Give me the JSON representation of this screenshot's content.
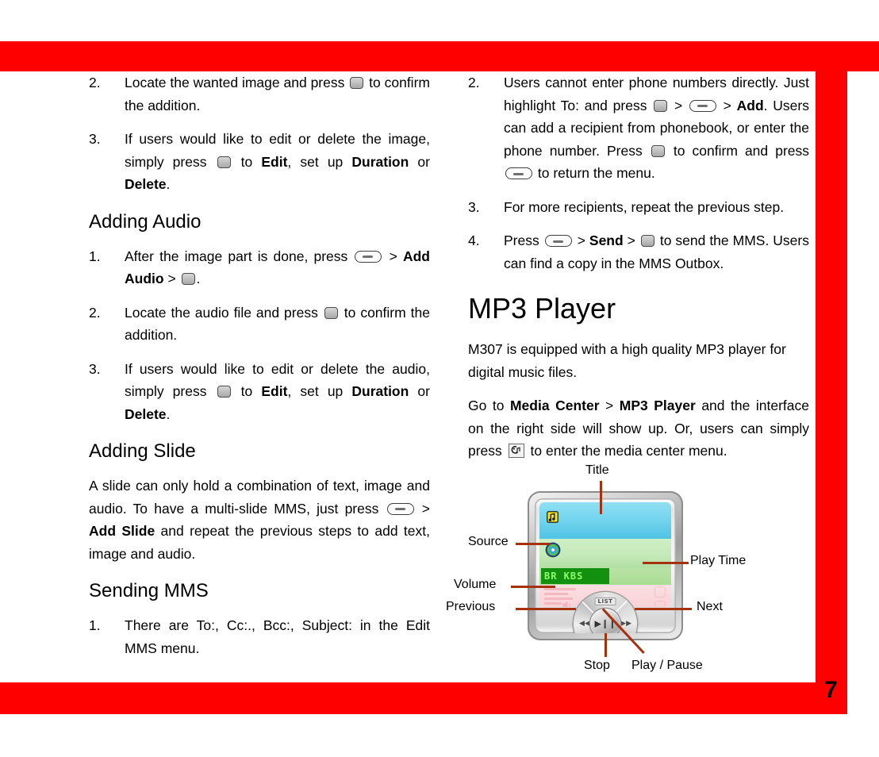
{
  "page": {
    "number": "7",
    "accent_red": "#fe0000",
    "callout_line_color": "#a5310e"
  },
  "left_column": {
    "items": [
      {
        "num": "2.",
        "segments": [
          {
            "t": "Locate the wanted image and press "
          },
          {
            "icon": "square-key-icon"
          },
          {
            "t": " to confirm the addition."
          }
        ]
      },
      {
        "num": "3.",
        "segments": [
          {
            "t": "If users would like to edit or delete the image, simply press "
          },
          {
            "icon": "square-key-icon"
          },
          {
            "t": " to "
          },
          {
            "b": "Edit"
          },
          {
            "t": ", set up "
          },
          {
            "b": "Duration"
          },
          {
            "t": " or "
          },
          {
            "b": "Delete"
          },
          {
            "t": "."
          }
        ]
      }
    ],
    "heading_adding_audio": "Adding Audio",
    "audio_items": [
      {
        "num": "1.",
        "segments": [
          {
            "t": "After the image part is done, press "
          },
          {
            "icon": "soft-key-icon"
          },
          {
            "t": " > "
          },
          {
            "b": "Add Audio"
          },
          {
            "t": " > "
          },
          {
            "icon": "square-key-icon"
          },
          {
            "t": "."
          }
        ]
      },
      {
        "num": "2.",
        "segments": [
          {
            "t": "Locate the audio file and press "
          },
          {
            "icon": "square-key-icon"
          },
          {
            "t": " to confirm the addition."
          }
        ]
      },
      {
        "num": "3.",
        "segments": [
          {
            "t": "If users would like to edit or delete the audio, simply press "
          },
          {
            "icon": "square-key-icon"
          },
          {
            "t": " to "
          },
          {
            "b": "Edit"
          },
          {
            "t": ", set up "
          },
          {
            "b": "Duration"
          },
          {
            "t": " or "
          },
          {
            "b": "Delete"
          },
          {
            "t": "."
          }
        ]
      }
    ],
    "heading_adding_slide": "Adding Slide",
    "slide_paragraph": [
      {
        "t": "A slide can only hold a combination of text, image and audio. To have a multi-slide MMS, just press "
      },
      {
        "icon": "soft-key-icon"
      },
      {
        "t": " > "
      },
      {
        "b": "Add Slide"
      },
      {
        "t": " and repeat the previous steps to add text, image and audio."
      }
    ],
    "heading_sending_mms": "Sending MMS",
    "mms_items": [
      {
        "num": "1.",
        "segments": [
          {
            "t": "There are To:, Cc:., Bcc:, Subject: in the Edit MMS menu."
          }
        ]
      }
    ]
  },
  "right_column": {
    "items": [
      {
        "num": "2.",
        "segments": [
          {
            "t": "Users cannot enter phone numbers directly. Just highlight To: and press "
          },
          {
            "icon": "square-key-icon"
          },
          {
            "t": " > "
          },
          {
            "icon": "soft-key-icon"
          },
          {
            "t": " > "
          },
          {
            "b": "Add"
          },
          {
            "t": ". Users can add a recipient from phonebook, or enter the phone number. Press "
          },
          {
            "icon": "square-key-icon"
          },
          {
            "t": " to confirm and press "
          },
          {
            "icon": "soft-key-icon"
          },
          {
            "t": " to return the menu."
          }
        ]
      },
      {
        "num": "3.",
        "segments": [
          {
            "t": "For more recipients, repeat the previous step."
          }
        ]
      },
      {
        "num": "4.",
        "segments": [
          {
            "t": "Press "
          },
          {
            "icon": "soft-key-icon"
          },
          {
            "t": " > "
          },
          {
            "b": "Send"
          },
          {
            "t": " > "
          },
          {
            "icon": "square-key-icon"
          },
          {
            "t": " to send the MMS. Users can find a copy in the MMS Outbox."
          }
        ]
      }
    ],
    "chapter_title": "MP3 Player",
    "paragraph_1": [
      {
        "t": "M307 is equipped with a high quality MP3 player for digital music files."
      }
    ],
    "paragraph_2": [
      {
        "t": "Go to "
      },
      {
        "b": "Media Center"
      },
      {
        "t": " > "
      },
      {
        "b": "MP3 Player"
      },
      {
        "t": " and the interface on the right side will show up. Or, users can simply press "
      },
      {
        "icon": "media-key-icon"
      },
      {
        "t": " to enter the media center menu."
      }
    ]
  },
  "figure": {
    "callouts": {
      "title": "Title",
      "source": "Source",
      "play_time": "Play Time",
      "volume": "Volume",
      "previous": "Previous",
      "next": "Next",
      "stop": "Stop",
      "play_pause": "Play / Pause"
    },
    "screen": {
      "bitrate_label": "BR      KBS",
      "list_key_label": "LIST",
      "prev_glyph": "◀◀",
      "next_glyph": "▶▶",
      "play_pause_glyph": "▶❙❙"
    }
  }
}
